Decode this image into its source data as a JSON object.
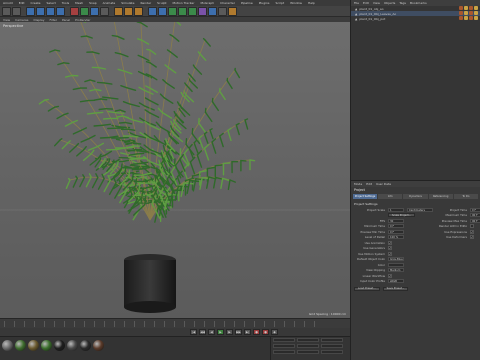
{
  "menubar": {
    "items": [
      "Arnold",
      "Edit",
      "Create",
      "Select",
      "Tools",
      "Mesh",
      "Snap",
      "Animate",
      "Simulate",
      "Render",
      "Sculpt",
      "Motion Tracker",
      "MoGraph",
      "Character",
      "Pipeline",
      "Plugins",
      "Script",
      "Window",
      "Help"
    ]
  },
  "toolbar": {
    "buttons": [
      {
        "icon": "undo-icon",
        "color": "#5a5a5a"
      },
      {
        "icon": "redo-icon",
        "color": "#5a5a5a"
      },
      {
        "icon": "live-select-icon",
        "color": "#3d6fae"
      },
      {
        "icon": "move-icon",
        "color": "#3d6fae"
      },
      {
        "icon": "scale-icon",
        "color": "#3d6fae"
      },
      {
        "icon": "rotate-icon",
        "color": "#3d6fae"
      },
      {
        "icon": "x-axis-icon",
        "color": "#a54040"
      },
      {
        "icon": "y-axis-icon",
        "color": "#3b8a4a"
      },
      {
        "icon": "z-axis-icon",
        "color": "#3d6fae"
      },
      {
        "icon": "coord-system-icon",
        "color": "#5a5a5a"
      },
      {
        "icon": "render-view-icon",
        "color": "#b07a2e"
      },
      {
        "icon": "render-picture-viewer-icon",
        "color": "#b07a2e"
      },
      {
        "icon": "render-settings-icon",
        "color": "#b07a2e"
      },
      {
        "icon": "cube-icon",
        "color": "#3d6fae"
      },
      {
        "icon": "spline-pen-icon",
        "color": "#3d6fae"
      },
      {
        "icon": "subdivision-icon",
        "color": "#3b8a4a"
      },
      {
        "icon": "array-icon",
        "color": "#3b8a4a"
      },
      {
        "icon": "cloner-icon",
        "color": "#3b8a4a"
      },
      {
        "icon": "deformer-icon",
        "color": "#7a52a8"
      },
      {
        "icon": "floor-icon",
        "color": "#3d6fae"
      },
      {
        "icon": "camera-icon",
        "color": "#5a5a5a"
      },
      {
        "icon": "light-icon",
        "color": "#b07a2e"
      }
    ]
  },
  "viewport": {
    "menu": [
      "View",
      "Cameras",
      "Display",
      "Filter",
      "Panel",
      "ProRender"
    ],
    "label": "Perspective",
    "status": "Grid Spacing : 10000 cm"
  },
  "object_manager": {
    "menu": [
      "File",
      "Edit",
      "View",
      "Objects",
      "Tags",
      "Bookmarks"
    ],
    "items": [
      {
        "label": "plant_01_obj_ao",
        "selected": false
      },
      {
        "label": "plant_01_Obj_Leaves_Ao",
        "selected": true
      },
      {
        "label": "plant_01_Obj_pot",
        "selected": false
      }
    ]
  },
  "attribute_manager": {
    "menu": [
      "Mode",
      "Edit",
      "User Data"
    ],
    "title": "Project",
    "tabs": [
      "Project Settings",
      "Info",
      "Dynamics",
      "Referencing",
      "To Do"
    ],
    "section": "Project Settings",
    "left_rows": [
      {
        "label": "Project Scale",
        "value": "1",
        "extra": "Centimeters"
      },
      {
        "label": "",
        "button": "Scale Project..."
      },
      {
        "label": "FPS",
        "value": "30"
      },
      {
        "label": "Minimum Time",
        "value": "0 F"
      },
      {
        "label": "Preview Min Time",
        "value": "0 F"
      },
      {
        "label": "Level of Detail",
        "value": "100 %"
      },
      {
        "label": "Use Animation",
        "check": true
      },
      {
        "label": "Use Generators",
        "check": true
      },
      {
        "label": "Use Motion System",
        "check": true
      },
      {
        "label": "Default Object Color",
        "value": "Gray-Blue"
      },
      {
        "label": "Color",
        "value": ""
      },
      {
        "label": "View Clipping",
        "value": "Medium"
      },
      {
        "label": "Linear Workflow",
        "check": true
      },
      {
        "label": "Input Color Profile",
        "value": "sRGB"
      }
    ],
    "right_rows": [
      {
        "label": "Project Time",
        "value": "0 F"
      },
      {
        "label": "Maximum Time",
        "value": "90 F"
      },
      {
        "label": "Preview Max Time",
        "value": "90 F"
      },
      {
        "label": "Render LOD in Editor",
        "check": false
      },
      {
        "label": "Use Expressions",
        "check": true
      },
      {
        "label": "Use Deformers",
        "check": true
      }
    ],
    "bottom_buttons": [
      "Load Preset...",
      "Save Preset..."
    ]
  },
  "materials": [
    {
      "icon": "material-1-icon",
      "color": "#6b6b6b"
    },
    {
      "icon": "material-2-icon",
      "color": "#3f6e2e"
    },
    {
      "icon": "material-3-icon",
      "color": "#6b5a2e"
    },
    {
      "icon": "material-4-icon",
      "color": "#3b6f2c"
    },
    {
      "icon": "material-5-icon",
      "color": "#1e1e1e"
    },
    {
      "icon": "material-6-icon",
      "color": "#4a4a4a"
    },
    {
      "icon": "material-7-icon",
      "color": "#2b2b2b"
    },
    {
      "icon": "material-8-icon",
      "color": "#5b3b2a"
    }
  ],
  "colors": {
    "pot": "#242424",
    "leaf_dark": "#2f6a2a",
    "leaf_light": "#5f9e43",
    "stem": "#8a7d4a"
  }
}
